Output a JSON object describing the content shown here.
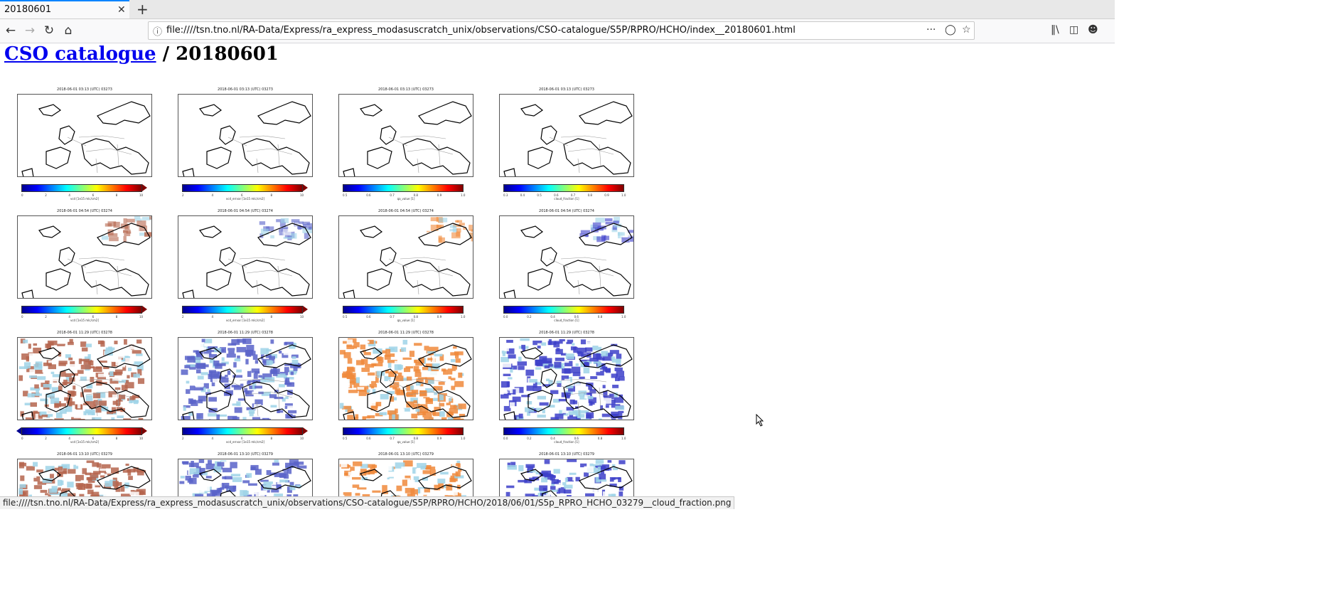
{
  "browser": {
    "tab_title": "20180601",
    "tab_close": "✕",
    "new_tab": "+",
    "url": "file:////tsn.tno.nl/RA-Data/Express/ra_express_modasuscratch_unix/observations/CSO-catalogue/S5P/RPRO/HCHO/index__20180601.html",
    "status_url": "file:////tsn.tno.nl/RA-Data/Express/ra_express_modasuscratch_unix/observations/CSO-catalogue/S5P/RPRO/HCHO/2018/06/01/S5p_RPRO_HCHO_03279__cloud_fraction.png"
  },
  "page": {
    "link_text": "CSO catalogue",
    "heading_rest": " / 20180601"
  },
  "rows": [
    {
      "title": "2018-06-01 03:13 (UTC) 03273",
      "fill": "none"
    },
    {
      "title": "2018-06-01 04:54 (UTC) 03274",
      "fill": "sparse"
    },
    {
      "title": "2018-06-01 11:29 (UTC) 03278",
      "fill": "dense"
    },
    {
      "title": "2018-06-01 13:10 (UTC) 03279",
      "fill": "dense"
    }
  ],
  "columns": [
    {
      "label": "vcd [1e15 mlc/cm2]",
      "ticks": [
        "0",
        "2",
        "4",
        "6",
        "8",
        "10"
      ],
      "colormap": "jet",
      "data_color": "#b5654d",
      "extend": "max"
    },
    {
      "label": "vcd_errvar [1e15 mlc/cm2]",
      "ticks": [
        "2",
        "4",
        "6",
        "8",
        "10"
      ],
      "colormap": "jet",
      "data_color": "#5963c9",
      "extend": "max"
    },
    {
      "label": "qa_value [1]",
      "ticks": [
        "0.5",
        "0.6",
        "0.7",
        "0.8",
        "0.9",
        "1.0"
      ],
      "colormap": "jet",
      "data_color": "#f08a3c",
      "extend": "none"
    },
    {
      "label": "cloud_fraction [1]",
      "ticks": [
        "0.3",
        "0.4",
        "0.5",
        "0.6",
        "0.7",
        "0.8",
        "0.9",
        "1.0"
      ],
      "colormap": "jet",
      "data_color": "#3d3fc9",
      "extend": "none"
    }
  ],
  "row2_ticks": [
    [
      "0",
      "2",
      "4",
      "6",
      "8",
      "10"
    ],
    [
      "2",
      "4",
      "6",
      "8",
      "10"
    ],
    [
      "0.5",
      "0.6",
      "0.7",
      "0.8",
      "0.9",
      "1.0"
    ],
    [
      "0.0",
      "0.2",
      "0.4",
      "0.6",
      "0.8",
      "1.0"
    ]
  ],
  "row3_ticks": [
    [
      "0",
      "2",
      "4",
      "6",
      "8",
      "10"
    ],
    [
      "2",
      "4",
      "6",
      "8",
      "10"
    ],
    [
      "0.5",
      "0.6",
      "0.7",
      "0.8",
      "0.9",
      "1.0"
    ],
    [
      "0.0",
      "0.2",
      "0.4",
      "0.6",
      "0.8",
      "1.0"
    ]
  ],
  "colors": {
    "link": "#0000ee",
    "tab_accent": "#0a84ff"
  }
}
